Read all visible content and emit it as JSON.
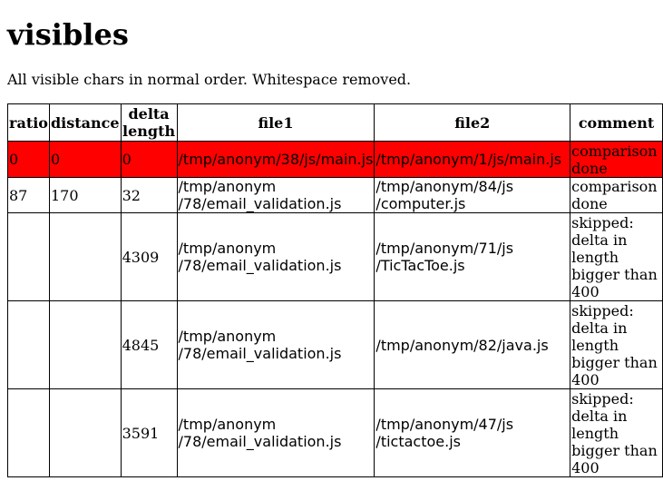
{
  "page": {
    "title": "visibles",
    "subtitle": "All visible chars in normal order. Whitespace removed."
  },
  "table": {
    "headers": [
      "ratio",
      "distance",
      "delta\nlength",
      "file1",
      "file2",
      "comment"
    ],
    "rows": [
      {
        "ratio": "0",
        "distance": "0",
        "delta": "0",
        "file1": "/tmp/anonym/38/js/main.js",
        "file2": "/tmp/anonym/1/js/main.js",
        "comment": "comparison done",
        "highlight_color": "#ff0000"
      },
      {
        "ratio": "87",
        "distance": "170",
        "delta": "32",
        "file1": "/tmp/anonym\n/78/email_validation.js",
        "file2": "/tmp/anonym/84/js\n/computer.js",
        "comment": "comparison done"
      },
      {
        "ratio": "",
        "distance": "",
        "delta": "4309",
        "file1": "/tmp/anonym\n/78/email_validation.js",
        "file2": "/tmp/anonym/71/js\n/TicTacToe.js",
        "comment": "skipped: delta in length bigger than 400"
      },
      {
        "ratio": "",
        "distance": "",
        "delta": "4845",
        "file1": "/tmp/anonym\n/78/email_validation.js",
        "file2": "/tmp/anonym/82/java.js",
        "comment": "skipped: delta in length bigger than 400"
      },
      {
        "ratio": "",
        "distance": "",
        "delta": "3591",
        "file1": "/tmp/anonym\n/78/email_validation.js",
        "file2": "/tmp/anonym/47/js\n/tictactoe.js",
        "comment": "skipped: delta in length bigger than 400"
      }
    ]
  }
}
